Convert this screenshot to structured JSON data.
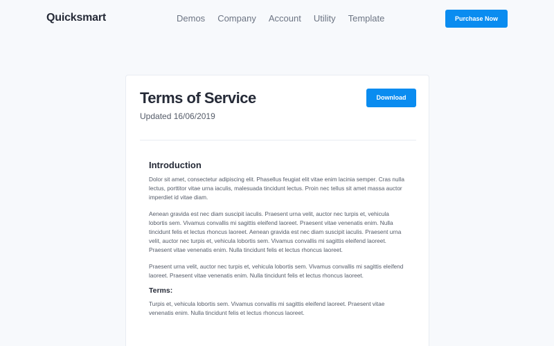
{
  "nav": {
    "brand": "Quicksmart",
    "links": [
      "Demos",
      "Company",
      "Account",
      "Utility",
      "Template"
    ],
    "purchase_label": "Purchase Now"
  },
  "doc": {
    "title": "Terms of Service",
    "updated": "Updated 16/06/2019",
    "download_label": "Download",
    "intro_heading": "Introduction",
    "paragraphs": [
      "Dolor sit amet, consectetur adipiscing elit. Phasellus feugiat elit vitae enim lacinia semper. Cras nulla lectus, porttitor vitae urna iaculis, malesuada tincidunt lectus. Proin nec tellus sit amet massa auctor imperdiet id vitae diam.",
      "Aenean gravida est nec diam suscipit iaculis. Praesent urna velit, auctor nec turpis et, vehicula lobortis sem. Vivamus convallis mi sagittis eleifend laoreet. Praesent vitae venenatis enim. Nulla tincidunt felis et lectus rhoncus laoreet. Aenean gravida est nec diam suscipit iaculis. Praesent urna velit, auctor nec turpis et, vehicula lobortis sem. Vivamus convallis mi sagittis eleifend laoreet. Praesent vitae venenatis enim. Nulla tincidunt felis et lectus rhoncus laoreet.",
      "Praesent urna velit, auctor nec turpis et, vehicula lobortis sem. Vivamus convallis mi sagittis eleifend laoreet. Praesent vitae venenatis enim. Nulla tincidunt felis et lectus rhoncus laoreet."
    ],
    "terms_heading": "Terms:",
    "terms_paragraph": "Turpis et, vehicula lobortis sem. Vivamus convallis mi sagittis eleifend laoreet. Praesent vitae venenatis enim. Nulla tincidunt felis et lectus rhoncus laoreet."
  },
  "colors": {
    "accent": "#0a8cf0",
    "background": "#f7f9fc",
    "heading": "#252a37",
    "body_text": "#545b68",
    "nav_text": "#6c7483"
  }
}
